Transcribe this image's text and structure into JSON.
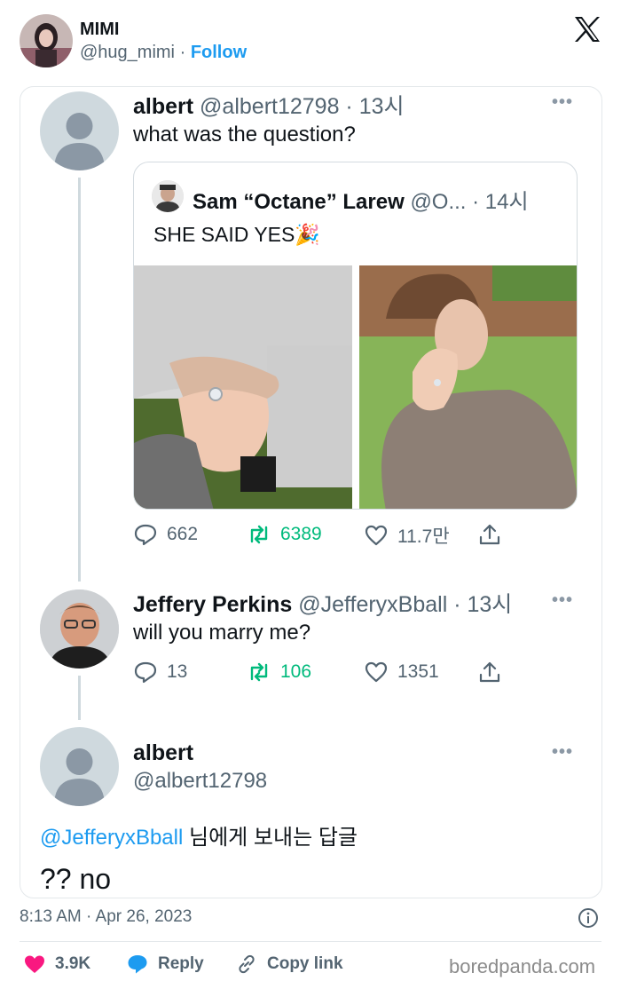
{
  "header": {
    "name": "MIMI",
    "handle": "@hug_mimi",
    "separator": "·",
    "follow_label": "Follow",
    "x_logo_icon": "x-logo-icon"
  },
  "thread": {
    "tweet1": {
      "name": "albert",
      "meta": "@albert12798 · 13시",
      "text": "what was the question?",
      "quote": {
        "name": "Sam “Octane” Larew",
        "meta": "@O... · 14시",
        "text": "SHE SAID YES",
        "emoji": "🎉"
      },
      "stats": {
        "replies": "662",
        "retweets": "6389",
        "likes": "11.7만"
      }
    },
    "tweet2": {
      "name": "Jeffery Perkins",
      "meta": "@JefferyxBball · 13시",
      "text": "will you marry me?",
      "stats": {
        "replies": "13",
        "retweets": "106",
        "likes": "1351"
      }
    },
    "tweet3": {
      "name": "albert",
      "handle": "@albert12798",
      "reply_to_mention": "@JefferyxBball",
      "reply_to_suffix": "님에게 보내는 답글",
      "text": "?? no"
    },
    "more_glyph": "•••"
  },
  "footer": {
    "timestamp": "8:13 AM · Apr 26, 2023",
    "likes": "3.9K",
    "reply_label": "Reply",
    "copy_link_label": "Copy link",
    "watermark": "boredpanda.com"
  },
  "colors": {
    "accent": "#1d9bf0",
    "retweet_green": "#00ba7c",
    "like_pink": "#f91880",
    "muted_text": "#536471"
  }
}
